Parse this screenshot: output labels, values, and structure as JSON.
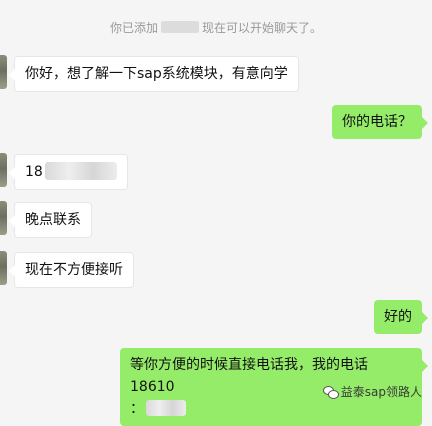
{
  "system_message": {
    "prefix": "你已添加",
    "suffix": "现在可以开始聊天了。"
  },
  "messages": [
    {
      "side": "in",
      "text": "你好，想了解一下sap系统模块，有意向学"
    },
    {
      "side": "out",
      "text": "你的电话？"
    },
    {
      "side": "in",
      "text": "18"
    },
    {
      "side": "in",
      "text": "晚点联系"
    },
    {
      "side": "in",
      "text": "现在不方便接听"
    },
    {
      "side": "out",
      "text": "好的"
    },
    {
      "side": "out",
      "line1": "等你方便的时候直接电话我，我的电话18610",
      "line2": "："
    }
  ],
  "watermark": {
    "text": "益泰sap领路人",
    "icon": "wechat-channel-icon"
  }
}
